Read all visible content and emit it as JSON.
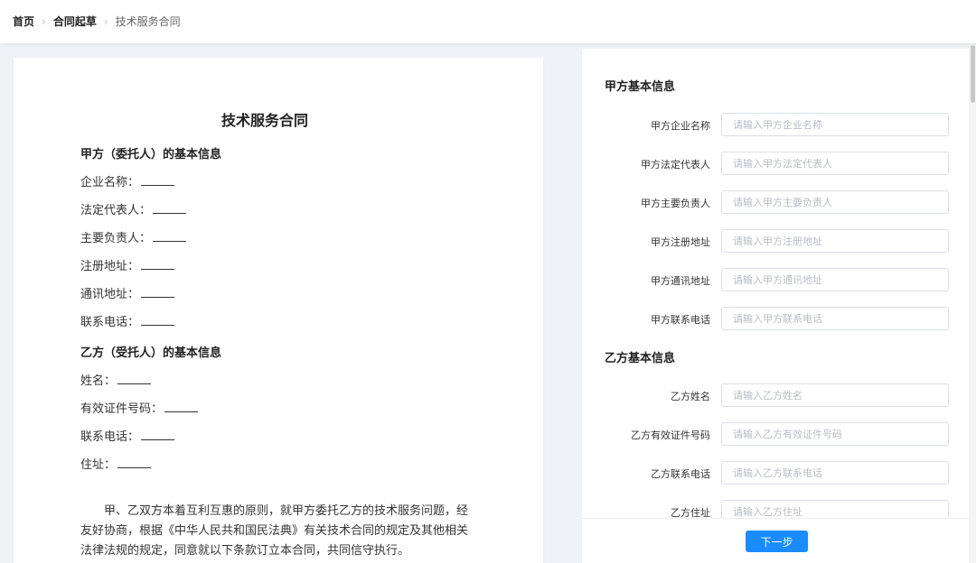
{
  "breadcrumb": {
    "home": "首页",
    "draft": "合同起草",
    "current": "技术服务合同"
  },
  "document": {
    "title": "技术服务合同",
    "party_a": {
      "heading": "甲方（委托人）的基本信息",
      "lines": [
        "企业名称：",
        "法定代表人：",
        "主要负责人：",
        "注册地址：",
        "通讯地址：",
        "联系电话："
      ]
    },
    "party_b": {
      "heading": "乙方（受托人）的基本信息",
      "lines": [
        "姓名：",
        "有效证件号码：",
        "联系电话：",
        "住址："
      ]
    },
    "preamble": "甲、乙双方本着互利互惠的原则，就甲方委托乙方的技术服务问题，经友好协商，根据《中华人民共和国民法典》有关技术合同的规定及其他相关法律法规的规定，同意就以下条款订立本合同，共同信守执行。"
  },
  "form": {
    "party_a": {
      "heading": "甲方基本信息",
      "fields": [
        {
          "label": "甲方企业名称",
          "placeholder": "请输入甲方企业名称",
          "value": ""
        },
        {
          "label": "甲方法定代表人",
          "placeholder": "请输入甲方法定代表人",
          "value": ""
        },
        {
          "label": "甲方主要负责人",
          "placeholder": "请输入甲方主要负责人",
          "value": ""
        },
        {
          "label": "甲方注册地址",
          "placeholder": "请输入甲方注册地址",
          "value": ""
        },
        {
          "label": "甲方通讯地址",
          "placeholder": "请输入甲方通讯地址",
          "value": ""
        },
        {
          "label": "甲方联系电话",
          "placeholder": "请输入甲方联系电话",
          "value": ""
        }
      ]
    },
    "party_b": {
      "heading": "乙方基本信息",
      "fields": [
        {
          "label": "乙方姓名",
          "placeholder": "请输入乙方姓名",
          "value": ""
        },
        {
          "label": "乙方有效证件号码",
          "placeholder": "请输入乙方有效证件号码",
          "value": ""
        },
        {
          "label": "乙方联系电话",
          "placeholder": "请输入乙方联系电话",
          "value": ""
        },
        {
          "label": "乙方住址",
          "placeholder": "请输入乙方住址",
          "value": ""
        }
      ]
    },
    "next_label": "下一步"
  },
  "colors": {
    "primary": "#1a8cff",
    "page_bg": "#f0f2f5"
  }
}
